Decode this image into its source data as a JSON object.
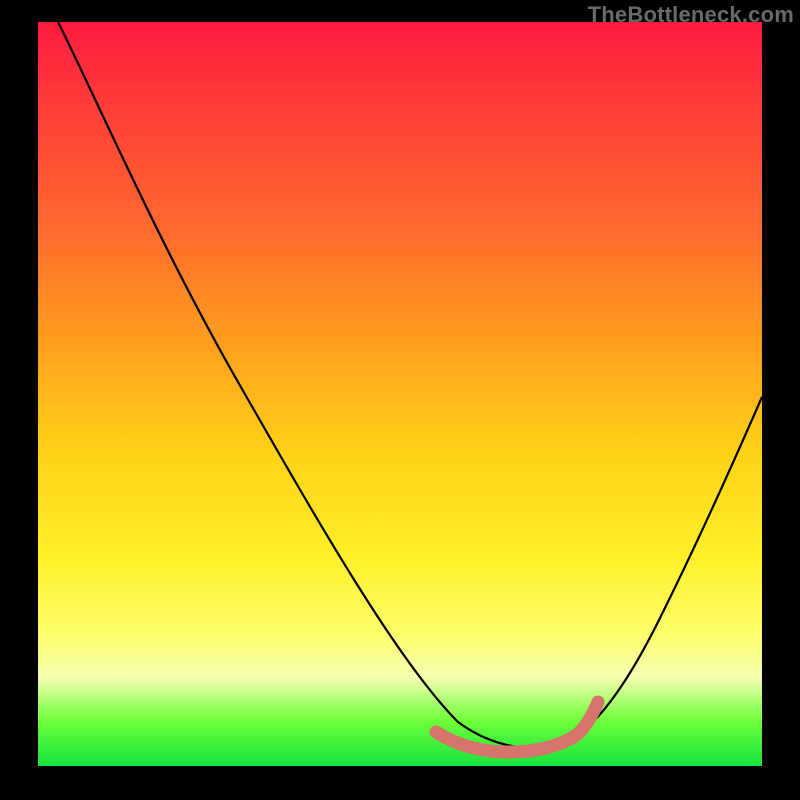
{
  "watermark": {
    "text": "TheBottleneck.com"
  },
  "chart_data": {
    "type": "line",
    "title": "",
    "xlabel": "",
    "ylabel": "",
    "xlim": [
      0,
      100
    ],
    "ylim": [
      0,
      100
    ],
    "gradient_stops": [
      {
        "pct": 0,
        "color": "#ff1a3f"
      },
      {
        "pct": 10,
        "color": "#ff3a3a"
      },
      {
        "pct": 28,
        "color": "#ff6a2d"
      },
      {
        "pct": 42,
        "color": "#ff9a1e"
      },
      {
        "pct": 58,
        "color": "#ffd217"
      },
      {
        "pct": 72,
        "color": "#fff028"
      },
      {
        "pct": 82,
        "color": "#fdff6a"
      },
      {
        "pct": 88,
        "color": "#f6ffb0"
      },
      {
        "pct": 94,
        "color": "#6dff3a"
      },
      {
        "pct": 100,
        "color": "#15e33e"
      }
    ],
    "series": [
      {
        "name": "bottleneck-curve",
        "stroke": "#000000",
        "x": [
          3,
          8,
          15,
          25,
          35,
          45,
          55,
          60,
          65,
          70,
          75,
          80,
          88,
          95,
          100
        ],
        "y": [
          100,
          92,
          80,
          62,
          44,
          27,
          12,
          6,
          3,
          2,
          3,
          8,
          22,
          38,
          50
        ]
      },
      {
        "name": "optimal-band",
        "stroke": "#d6746c",
        "x": [
          55,
          60,
          65,
          70,
          73,
          75
        ],
        "y": [
          7,
          3,
          2,
          2,
          4,
          8
        ]
      }
    ]
  }
}
